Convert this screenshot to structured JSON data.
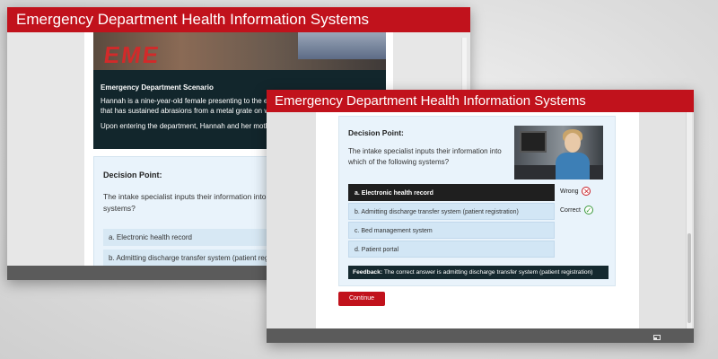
{
  "app_title": "Emergency Department Health Information Systems",
  "back_window": {
    "hero_sign": "EME",
    "scenario": {
      "title": "Emergency Department Scenario",
      "text1": "Hannah is a nine-year-old female presenting to the emergency department from a fall that has sustained abrasions from a metal grate on which she fell.",
      "text2": "Upon entering the department, Hannah and her mother are greeted"
    },
    "decision": {
      "title": "Decision Point:",
      "question": "The intake specialist inputs their information into which of the following systems?",
      "options": [
        "a. Electronic health record",
        "b. Admitting discharge transfer system (patient registration)"
      ]
    }
  },
  "front_window": {
    "decision": {
      "title": "Decision Point:",
      "question": "The intake specialist inputs their information into which of the following systems?",
      "options": [
        "a. Electronic health record",
        "b. Admitting discharge transfer system (patient registration)",
        "c. Bed management system",
        "d. Patient portal"
      ],
      "selected_index": 0,
      "verdicts": [
        {
          "label": "Wrong",
          "icon": "wrong-x-icon",
          "glyph": "✕",
          "color": "#c81d25"
        },
        {
          "label": "Correct",
          "icon": "correct-check-icon",
          "glyph": "✓",
          "color": "#3c9a3c"
        }
      ],
      "feedback_label": "Feedback:",
      "feedback_text": " The correct answer is admitting discharge transfer system (patient registration)"
    },
    "continue_label": "Continue"
  },
  "colors": {
    "brand_red": "#c1121c",
    "dark_panel": "#15292f",
    "option_bg": "#d2e6f5",
    "panel_bg": "#e9f3fb"
  }
}
